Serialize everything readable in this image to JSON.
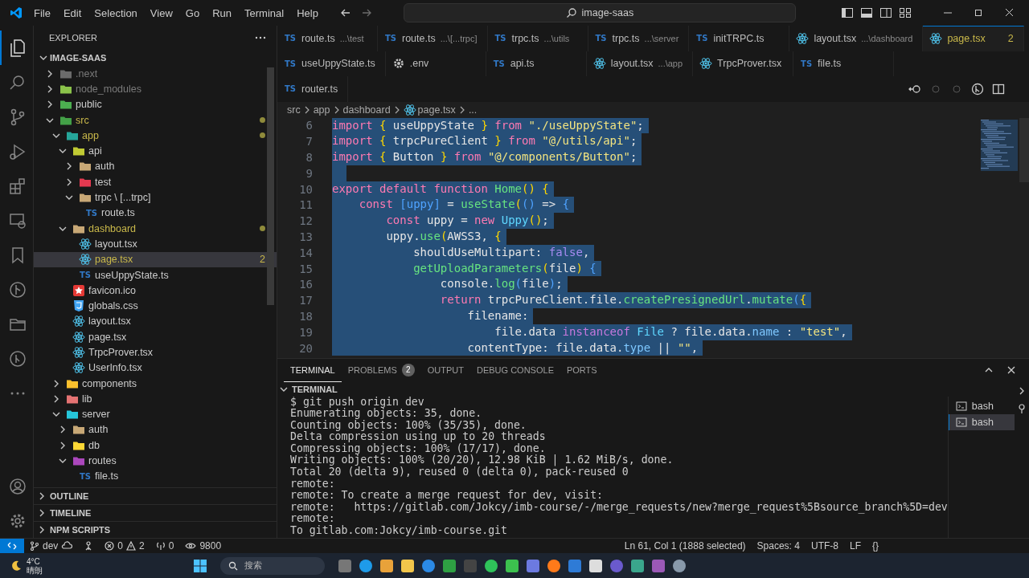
{
  "window": {
    "menu": [
      "File",
      "Edit",
      "Selection",
      "View",
      "Go",
      "Run",
      "Terminal",
      "Help"
    ],
    "command_center": "image-saas"
  },
  "activity_bar": {
    "items": [
      {
        "selected": true
      },
      {
        "selected": false
      },
      {
        "selected": false
      },
      {
        "selected": false
      },
      {
        "selected": false
      },
      {
        "selected": false
      },
      {
        "selected": false
      },
      {
        "selected": false
      },
      {
        "selected": false
      },
      {
        "selected": false
      },
      {
        "selected": false
      }
    ]
  },
  "explorer": {
    "title": "EXPLORER",
    "root": "IMAGE-SAAS",
    "tree": [
      {
        "label": ".next",
        "kind": "folder",
        "color": "#6b6b6b",
        "expanded": false,
        "selected": false,
        "modified": false,
        "ignored": true
      },
      {
        "label": "node_modules",
        "kind": "folder",
        "color": "#8bc34a",
        "expanded": false,
        "selected": false,
        "modified": false,
        "ignored": true
      },
      {
        "label": "public",
        "kind": "folder",
        "color": "#4caf50",
        "expanded": false,
        "selected": false,
        "modified": false,
        "ignored": false
      },
      {
        "label": "src",
        "kind": "folder",
        "color": "#43a047",
        "expanded": true,
        "selected": false,
        "modified": true,
        "ignored": false,
        "children": [
          {
            "label": "app",
            "kind": "folder",
            "color": "#26a69a",
            "expanded": true,
            "selected": false,
            "modified": true,
            "ignored": false,
            "children": [
              {
                "label": "api",
                "kind": "folder",
                "color": "#c0ca33",
                "expanded": true,
                "selected": false,
                "modified": false,
                "ignored": false,
                "children": [
                  {
                    "label": "auth",
                    "kind": "folder",
                    "color": "#c8a876",
                    "expanded": false,
                    "selected": false,
                    "modified": false,
                    "ignored": false
                  },
                  {
                    "label": "test",
                    "kind": "folder",
                    "color": "#e53950",
                    "expanded": false,
                    "selected": false,
                    "modified": false,
                    "ignored": false
                  },
                  {
                    "label": "trpc \\ [...trpc]",
                    "kind": "folder",
                    "color": "#c8a876",
                    "expanded": true,
                    "selected": false,
                    "modified": false,
                    "ignored": false,
                    "children": [
                      {
                        "label": "route.ts",
                        "kind": "ts",
                        "icon_text": "TS",
                        "selected": false,
                        "modified": false,
                        "ignored": false
                      }
                    ]
                  }
                ]
              },
              {
                "label": "dashboard",
                "kind": "folder",
                "color": "#c8a876",
                "expanded": true,
                "selected": false,
                "modified": true,
                "ignored": false,
                "children": [
                  {
                    "label": "layout.tsx",
                    "kind": "react",
                    "selected": false,
                    "modified": false,
                    "ignored": false
                  },
                  {
                    "label": "page.tsx",
                    "kind": "react",
                    "selected": true,
                    "modified": false,
                    "ignored": false,
                    "badge": "2"
                  },
                  {
                    "label": "useUppyState.ts",
                    "kind": "ts",
                    "icon_text": "TS",
                    "selected": false,
                    "modified": false,
                    "ignored": false
                  }
                ]
              },
              {
                "label": "favicon.ico",
                "kind": "star",
                "selected": false,
                "modified": false,
                "ignored": false
              },
              {
                "label": "globals.css",
                "kind": "css",
                "selected": false,
                "modified": false,
                "ignored": false
              },
              {
                "label": "layout.tsx",
                "kind": "react",
                "selected": false,
                "modified": false,
                "ignored": false
              },
              {
                "label": "page.tsx",
                "kind": "react",
                "selected": false,
                "modified": false,
                "ignored": false
              },
              {
                "label": "TrpcProver.tsx",
                "kind": "react",
                "selected": false,
                "modified": false,
                "ignored": false
              },
              {
                "label": "UserInfo.tsx",
                "kind": "react",
                "selected": false,
                "modified": false,
                "ignored": false
              }
            ]
          },
          {
            "label": "components",
            "kind": "folder",
            "color": "#fbc02d",
            "expanded": false,
            "selected": false,
            "modified": false,
            "ignored": false
          },
          {
            "label": "lib",
            "kind": "folder",
            "color": "#e57373",
            "expanded": false,
            "selected": false,
            "modified": false,
            "ignored": false
          },
          {
            "label": "server",
            "kind": "folder",
            "color": "#26c6da",
            "expanded": true,
            "selected": false,
            "modified": false,
            "ignored": false,
            "children": [
              {
                "label": "auth",
                "kind": "folder",
                "color": "#c8a876",
                "expanded": false,
                "selected": false,
                "modified": false,
                "ignored": false
              },
              {
                "label": "db",
                "kind": "folder",
                "color": "#fdd835",
                "expanded": false,
                "selected": false,
                "modified": false,
                "ignored": false
              },
              {
                "label": "routes",
                "kind": "folder",
                "color": "#ab47bc",
                "expanded": true,
                "selected": false,
                "modified": false,
                "ignored": false,
                "children": [
                  {
                    "label": "file.ts",
                    "kind": "ts",
                    "icon_text": "TS",
                    "selected": false,
                    "modified": false,
                    "ignored": false
                  }
                ]
              }
            ]
          }
        ]
      }
    ],
    "sections": [
      "OUTLINE",
      "TIMELINE",
      "NPM SCRIPTS"
    ]
  },
  "tab_rows": [
    {
      "tabs": [
        {
          "name": "route.ts",
          "path": "...\\test",
          "kind": "ts",
          "icon_text": "TS",
          "selected": false
        },
        {
          "name": "route.ts",
          "path": "...\\[...trpc]",
          "kind": "ts",
          "icon_text": "TS",
          "selected": false
        },
        {
          "name": "trpc.ts",
          "path": "...\\utils",
          "kind": "ts",
          "icon_text": "TS",
          "selected": false
        },
        {
          "name": "trpc.ts",
          "path": "...\\server",
          "kind": "ts",
          "icon_text": "TS",
          "selected": false
        },
        {
          "name": "initTRPC.ts",
          "kind": "ts",
          "icon_text": "TS",
          "selected": false
        },
        {
          "name": "layout.tsx",
          "path": "...\\dashboard",
          "kind": "react",
          "selected": false
        },
        {
          "name": "page.tsx",
          "kind": "react",
          "selected": true,
          "badge": "2"
        }
      ]
    },
    {
      "tabs": [
        {
          "name": "useUppyState.ts",
          "kind": "ts",
          "icon_text": "TS",
          "selected": false
        },
        {
          "name": ".env",
          "kind": "gear",
          "selected": false
        },
        {
          "name": "api.ts",
          "kind": "ts",
          "icon_text": "TS",
          "selected": false
        },
        {
          "name": "layout.tsx",
          "path": "...\\app",
          "kind": "react",
          "selected": false
        },
        {
          "name": "TrpcProver.tsx",
          "kind": "react",
          "selected": false
        },
        {
          "name": "file.ts",
          "kind": "ts",
          "icon_text": "TS",
          "selected": false
        }
      ]
    },
    {
      "tabs": [
        {
          "name": "router.ts",
          "kind": "ts",
          "icon_text": "TS",
          "selected": false
        }
      ]
    }
  ],
  "breadcrumb": [
    {
      "label": "src",
      "kind": "text"
    },
    {
      "label": "app",
      "kind": "text"
    },
    {
      "label": "dashboard",
      "kind": "text"
    },
    {
      "label": "page.tsx",
      "kind": "react"
    },
    {
      "label": "...",
      "kind": "text"
    }
  ],
  "code": [
    {
      "n": "6",
      "selected": true,
      "tokens": [
        {
          "kind": "kw",
          "text": "import"
        },
        {
          "kind": "br",
          "text": " {"
        },
        {
          "kind": "p",
          "text": " useUppyState "
        },
        {
          "kind": "br",
          "text": "}"
        },
        {
          "kind": "kw",
          "text": " from"
        },
        {
          "kind": "str",
          "text": " \"./useUppyState\""
        },
        {
          "kind": "p",
          "text": ";"
        }
      ]
    },
    {
      "n": "7",
      "selected": true,
      "tokens": [
        {
          "kind": "kw",
          "text": "import"
        },
        {
          "kind": "br",
          "text": " {"
        },
        {
          "kind": "p",
          "text": " trpcPureClient "
        },
        {
          "kind": "br",
          "text": "}"
        },
        {
          "kind": "kw",
          "text": " from"
        },
        {
          "kind": "str",
          "text": " \"@/utils/api\""
        },
        {
          "kind": "p",
          "text": ";"
        }
      ]
    },
    {
      "n": "8",
      "selected": true,
      "tokens": [
        {
          "kind": "kw",
          "text": "import"
        },
        {
          "kind": "br",
          "text": " {"
        },
        {
          "kind": "p",
          "text": " Button "
        },
        {
          "kind": "br",
          "text": "}"
        },
        {
          "kind": "kw",
          "text": " from"
        },
        {
          "kind": "str",
          "text": " \"@/components/Button\""
        },
        {
          "kind": "p",
          "text": ";"
        }
      ]
    },
    {
      "n": "9",
      "selected": true
    },
    {
      "n": "10",
      "selected": true,
      "tokens": [
        {
          "kind": "kw",
          "text": "export default function"
        },
        {
          "kind": "fn",
          "text": " Home"
        },
        {
          "kind": "br",
          "text": "()"
        },
        {
          "kind": "br",
          "text": " {"
        }
      ]
    },
    {
      "n": "11",
      "selected": true,
      "tokens": [
        {
          "kind": "kw",
          "text": "    const"
        },
        {
          "kind": "br2",
          "text": " [uppy]"
        },
        {
          "kind": "p",
          "text": " = "
        },
        {
          "kind": "fn",
          "text": "useState"
        },
        {
          "kind": "br",
          "text": "("
        },
        {
          "kind": "br2",
          "text": "()"
        },
        {
          "kind": "p",
          "text": " => "
        },
        {
          "kind": "br2",
          "text": "{"
        }
      ]
    },
    {
      "n": "12",
      "selected": true,
      "tokens": [
        {
          "kind": "kw",
          "text": "        const"
        },
        {
          "kind": "p",
          "text": " uppy = "
        },
        {
          "kind": "kw",
          "text": "new"
        },
        {
          "kind": "ty",
          "text": " Uppy"
        },
        {
          "kind": "br",
          "text": "()"
        },
        {
          "kind": "p",
          "text": ";"
        }
      ]
    },
    {
      "n": "13",
      "selected": true,
      "tokens": [
        {
          "kind": "p",
          "text": "        uppy."
        },
        {
          "kind": "fn",
          "text": "use"
        },
        {
          "kind": "br",
          "text": "("
        },
        {
          "kind": "p",
          "text": "AWSS3, "
        },
        {
          "kind": "br",
          "text": "{"
        }
      ]
    },
    {
      "n": "14",
      "selected": true,
      "tokens": [
        {
          "kind": "p",
          "text": "            shouldUseMultipart: "
        },
        {
          "kind": "bool",
          "text": "false"
        },
        {
          "kind": "p",
          "text": ","
        }
      ]
    },
    {
      "n": "15",
      "selected": true,
      "tokens": [
        {
          "kind": "fn",
          "text": "            getUploadParameters"
        },
        {
          "kind": "br",
          "text": "("
        },
        {
          "kind": "p",
          "text": "file"
        },
        {
          "kind": "br",
          "text": ")"
        },
        {
          "kind": "br2",
          "text": " {"
        }
      ]
    },
    {
      "n": "16",
      "selected": true,
      "tokens": [
        {
          "kind": "p",
          "text": "                console."
        },
        {
          "kind": "fn",
          "text": "log"
        },
        {
          "kind": "br2",
          "text": "("
        },
        {
          "kind": "p",
          "text": "file"
        },
        {
          "kind": "br2",
          "text": ")"
        },
        {
          "kind": "p",
          "text": ";"
        }
      ]
    },
    {
      "n": "17",
      "selected": true,
      "tokens": [
        {
          "kind": "kw",
          "text": "                return"
        },
        {
          "kind": "p",
          "text": " trpcPureClient.file."
        },
        {
          "kind": "fn",
          "text": "createPresignedUrl"
        },
        {
          "kind": "p",
          "text": "."
        },
        {
          "kind": "fn",
          "text": "mutate"
        },
        {
          "kind": "br2",
          "text": "("
        },
        {
          "kind": "br",
          "text": "{"
        }
      ]
    },
    {
      "n": "18",
      "selected": true,
      "tokens": [
        {
          "kind": "p",
          "text": "                    filename:"
        }
      ]
    },
    {
      "n": "19",
      "selected": true,
      "tokens": [
        {
          "kind": "p",
          "text": "                        file.data "
        },
        {
          "kind": "kw2",
          "text": "instanceof"
        },
        {
          "kind": "ty",
          "text": " File"
        },
        {
          "kind": "p",
          "text": " ? file.data."
        },
        {
          "kind": "prop",
          "text": "name"
        },
        {
          "kind": "p",
          "text": " : "
        },
        {
          "kind": "str",
          "text": "\"test\""
        },
        {
          "kind": "p",
          "text": ","
        }
      ]
    },
    {
      "n": "20",
      "selected": true,
      "tokens": [
        {
          "kind": "p",
          "text": "                    contentType: file.data."
        },
        {
          "kind": "prop",
          "text": "type"
        },
        {
          "kind": "p",
          "text": " || "
        },
        {
          "kind": "str",
          "text": "\"\""
        },
        {
          "kind": "p",
          "text": ","
        }
      ]
    }
  ],
  "panel": {
    "tabs": [
      {
        "label": "TERMINAL",
        "selected": true
      },
      {
        "label": "PROBLEMS",
        "count": "2",
        "selected": false
      },
      {
        "label": "OUTPUT",
        "selected": false
      },
      {
        "label": "DEBUG CONSOLE",
        "selected": false
      },
      {
        "label": "PORTS",
        "selected": false
      }
    ],
    "section": "TERMINAL",
    "terminal_lines": [
      "$ git push origin dev",
      "Enumerating objects: 35, done.",
      "Counting objects: 100% (35/35), done.",
      "Delta compression using up to 20 threads",
      "Compressing objects: 100% (17/17), done.",
      "Writing objects: 100% (20/20), 12.98 KiB | 1.62 MiB/s, done.",
      "Total 20 (delta 9), reused 0 (delta 0), pack-reused 0",
      "remote:",
      "remote: To create a merge request for dev, visit:",
      "remote:   https://gitlab.com/Jokcy/imb-course/-/merge_requests/new?merge_request%5Bsource_branch%5D=dev",
      "remote:",
      "To gitlab.com:Jokcy/imb-course.git"
    ],
    "terminals": [
      {
        "label": "bash",
        "selected": false
      },
      {
        "label": "bash",
        "selected": true
      }
    ]
  },
  "status_bar": {
    "branch": "dev",
    "errors": "0",
    "warnings": "2",
    "ports": "0",
    "watch": "9800",
    "right": [
      "Ln 61, Col 1 (1888 selected)",
      "Spaces: 4",
      "UTF-8",
      "LF",
      "{}"
    ]
  },
  "taskbar": {
    "temperature": "4°C",
    "weather": "晴朗",
    "search": "搜索"
  }
}
